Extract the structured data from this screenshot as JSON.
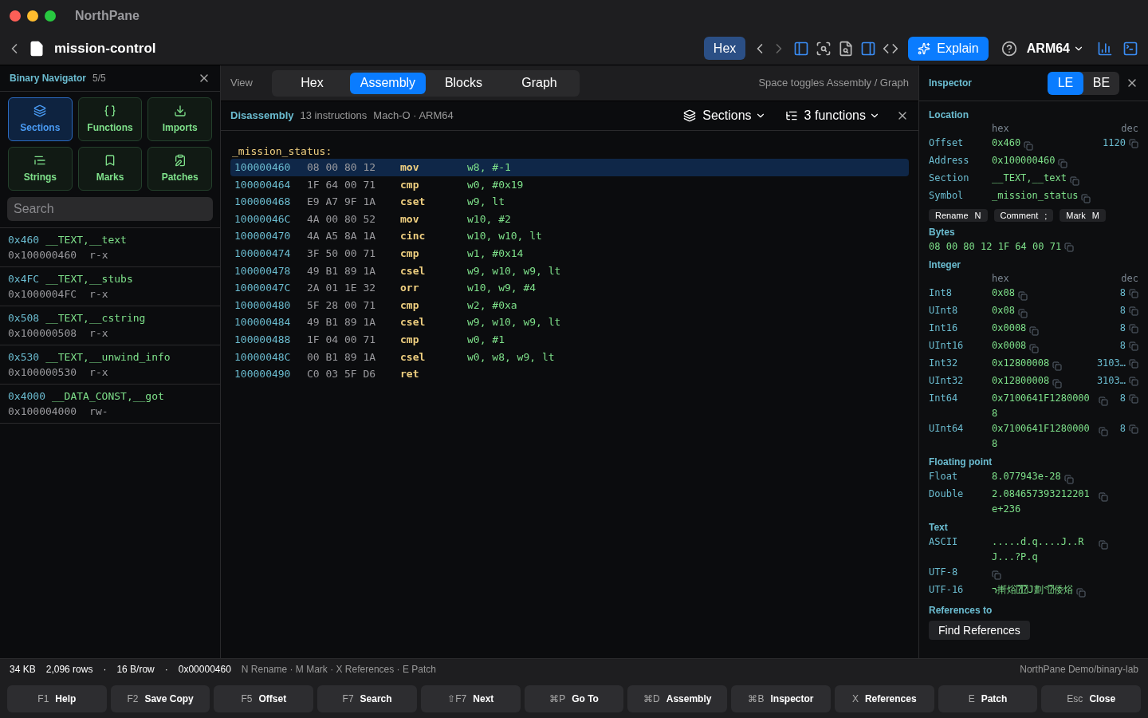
{
  "window": {
    "title": "NorthPane"
  },
  "toolbar": {
    "file": "mission-control",
    "mode_button": "Hex",
    "explain": "Explain",
    "arch": "ARM64"
  },
  "navigator": {
    "title": "Binary Navigator",
    "count": "5/5",
    "buttons": [
      {
        "kind": "sections",
        "label": "Sections",
        "selected": true
      },
      {
        "kind": "functions",
        "label": "Functions",
        "selected": false
      },
      {
        "kind": "imports",
        "label": "Imports",
        "selected": false
      },
      {
        "kind": "strings",
        "label": "Strings",
        "selected": false
      },
      {
        "kind": "marks",
        "label": "Marks",
        "selected": false
      },
      {
        "kind": "patches",
        "label": "Patches",
        "selected": false
      }
    ],
    "search": {
      "placeholder": "Search"
    },
    "sections": [
      {
        "offset": "0x460",
        "name": "__TEXT,__text",
        "address": "0x100000460",
        "perms": "r-x"
      },
      {
        "offset": "0x4FC",
        "name": "__TEXT,__stubs",
        "address": "0x1000004FC",
        "perms": "r-x"
      },
      {
        "offset": "0x508",
        "name": "__TEXT,__cstring",
        "address": "0x100000508",
        "perms": "r-x"
      },
      {
        "offset": "0x530",
        "name": "__TEXT,__unwind_info",
        "address": "0x100000530",
        "perms": "r-x"
      },
      {
        "offset": "0x4000",
        "name": "__DATA_CONST,__got",
        "address": "0x100004000",
        "perms": "rw-"
      }
    ]
  },
  "view": {
    "label": "View",
    "tabs": [
      {
        "label": "Hex",
        "selected": false
      },
      {
        "label": "Assembly",
        "selected": true
      },
      {
        "label": "Blocks",
        "selected": false
      },
      {
        "label": "Graph",
        "selected": false
      }
    ],
    "hint": "Space toggles Assembly / Graph"
  },
  "disassembly": {
    "title": "Disassembly",
    "count": "13 instructions",
    "format": "Mach-O · ARM64",
    "sections_menu": "Sections",
    "functions_menu": "3 functions",
    "label": "_mission_status:",
    "rows": [
      {
        "address": "100000460",
        "bytes": "08 00 80 12",
        "mnemonic": "mov",
        "operands": "w8, #-1",
        "selected": true
      },
      {
        "address": "100000464",
        "bytes": "1F 64 00 71",
        "mnemonic": "cmp",
        "operands": "w0, #0x19",
        "selected": false
      },
      {
        "address": "100000468",
        "bytes": "E9 A7 9F 1A",
        "mnemonic": "cset",
        "operands": "w9, lt",
        "selected": false
      },
      {
        "address": "10000046C",
        "bytes": "4A 00 80 52",
        "mnemonic": "mov",
        "operands": "w10, #2",
        "selected": false
      },
      {
        "address": "100000470",
        "bytes": "4A A5 8A 1A",
        "mnemonic": "cinc",
        "operands": "w10, w10, lt",
        "selected": false
      },
      {
        "address": "100000474",
        "bytes": "3F 50 00 71",
        "mnemonic": "cmp",
        "operands": "w1, #0x14",
        "selected": false
      },
      {
        "address": "100000478",
        "bytes": "49 B1 89 1A",
        "mnemonic": "csel",
        "operands": "w9, w10, w9, lt",
        "selected": false
      },
      {
        "address": "10000047C",
        "bytes": "2A 01 1E 32",
        "mnemonic": "orr",
        "operands": "w10, w9, #4",
        "selected": false
      },
      {
        "address": "100000480",
        "bytes": "5F 28 00 71",
        "mnemonic": "cmp",
        "operands": "w2, #0xa",
        "selected": false
      },
      {
        "address": "100000484",
        "bytes": "49 B1 89 1A",
        "mnemonic": "csel",
        "operands": "w9, w10, w9, lt",
        "selected": false
      },
      {
        "address": "100000488",
        "bytes": "1F 04 00 71",
        "mnemonic": "cmp",
        "operands": "w0, #1",
        "selected": false
      },
      {
        "address": "10000048C",
        "bytes": "00 B1 89 1A",
        "mnemonic": "csel",
        "operands": "w0, w8, w9, lt",
        "selected": false
      },
      {
        "address": "100000490",
        "bytes": "C0 03 5F D6",
        "mnemonic": "ret",
        "operands": "",
        "selected": false
      }
    ]
  },
  "inspector": {
    "title": "Inspector",
    "endian": [
      {
        "label": "LE",
        "selected": true
      },
      {
        "label": "BE",
        "selected": false
      }
    ],
    "location": {
      "heading": "Location",
      "hex_header": "hex",
      "dec_header": "dec",
      "rows": [
        {
          "label": "Offset",
          "value": "0x460",
          "dec": "1120"
        },
        {
          "label": "Address",
          "value": "0x100000460"
        },
        {
          "label": "Section",
          "value": "__TEXT,__text"
        },
        {
          "label": "Symbol",
          "value": "_mission_status"
        }
      ],
      "actions": [
        {
          "label": "Rename",
          "key": "N"
        },
        {
          "label": "Comment",
          "key": ";"
        },
        {
          "label": "Mark",
          "key": "M"
        }
      ]
    },
    "bytes": {
      "heading": "Bytes",
      "value": "08 00 80 12 1F 64 00 71"
    },
    "integer": {
      "heading": "Integer",
      "hex_header": "hex",
      "dec_header": "dec",
      "rows": [
        {
          "label": "Int8",
          "value": "0x08",
          "dec": "8"
        },
        {
          "label": "UInt8",
          "value": "0x08",
          "dec": "8"
        },
        {
          "label": "Int16",
          "value": "0x0008",
          "dec": "8"
        },
        {
          "label": "UInt16",
          "value": "0x0008",
          "dec": "8"
        },
        {
          "label": "Int32",
          "value": "0x12800008",
          "dec": "3103…"
        },
        {
          "label": "UInt32",
          "value": "0x12800008",
          "dec": "3103…"
        },
        {
          "label": "Int64",
          "value": "0x7100641F12800008",
          "dec": "8"
        },
        {
          "label": "UInt64",
          "value": "0x7100641F12800008",
          "dec": "8"
        }
      ]
    },
    "floating": {
      "heading": "Floating point",
      "rows": [
        {
          "label": "Float",
          "value": "8.077943e-28"
        },
        {
          "label": "Double",
          "value": "2.084657393212201e+236"
        }
      ]
    },
    "text": {
      "heading": "Text",
      "rows": [
        {
          "label": "ASCII",
          "value": ".....d.q....J..RJ...?P.q"
        },
        {
          "label": "UTF-8",
          "value": ""
        },
        {
          "label": "UTF-16",
          "value": "ኀ搟焀⍰⍰J劃ᕝ⍰倭焀"
        }
      ]
    },
    "references": {
      "heading": "References to",
      "button": "Find References"
    }
  },
  "status_bar": {
    "items": [
      "34 KB",
      "2,096 rows",
      "·",
      "16 B/row",
      "·",
      "0x00000460"
    ],
    "hint": "N Rename · M Mark · X References · E Patch",
    "path": "NorthPane Demo/binary-lab"
  },
  "function_keys": [
    {
      "key": "F1",
      "label": "Help"
    },
    {
      "key": "F2",
      "label": "Save Copy"
    },
    {
      "key": "F5",
      "label": "Offset"
    },
    {
      "key": "F7",
      "label": "Search"
    },
    {
      "key": "⇧F7",
      "label": "Next"
    },
    {
      "key": "⌘P",
      "label": "Go To"
    },
    {
      "key": "⌘D",
      "label": "Assembly"
    },
    {
      "key": "⌘B",
      "label": "Inspector"
    },
    {
      "key": "X",
      "label": "References"
    },
    {
      "key": "E",
      "label": "Patch"
    },
    {
      "key": "Esc",
      "label": "Close"
    }
  ]
}
